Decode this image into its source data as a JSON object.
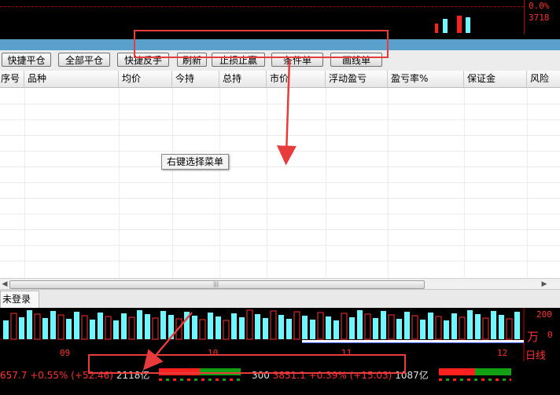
{
  "top_chart": {
    "pct_label": "0.0%",
    "volume_label": "3718"
  },
  "toolbar": {
    "buttons": [
      "快捷平仓",
      "全部平仓",
      "快捷反手",
      "刷新",
      "止损止赢",
      "条件单",
      "画线单"
    ]
  },
  "table": {
    "columns": [
      "序号",
      "品种",
      "均价",
      "今持",
      "总持",
      "市价",
      "浮动盈亏",
      "盈亏率%",
      "保证金",
      "风险"
    ]
  },
  "context_hint": "右键选择菜单",
  "status": {
    "tab_label": "未登录"
  },
  "bottom_chart": {
    "y_top": "200",
    "y_bottom": "0",
    "unit": "万",
    "time_labels": [
      "09",
      "10",
      "11",
      "12"
    ],
    "period_label": "日线"
  },
  "ticker": {
    "index1_value": "657.7",
    "index1_change_pct": "+0.55%",
    "index1_change_pts": "(+52.46)",
    "index1_amount": "2118亿",
    "index2_name": "300",
    "index2_value": "3851.1",
    "index2_change_pct": "+0.39%",
    "index2_change_pts": "(+15.03)",
    "index2_amount": "1087亿"
  },
  "colors": {
    "up_red": "#ff3030",
    "bar_cyan": "#6ff6ff",
    "annotation_red": "#e83c3c",
    "up_green": "#14a014"
  }
}
